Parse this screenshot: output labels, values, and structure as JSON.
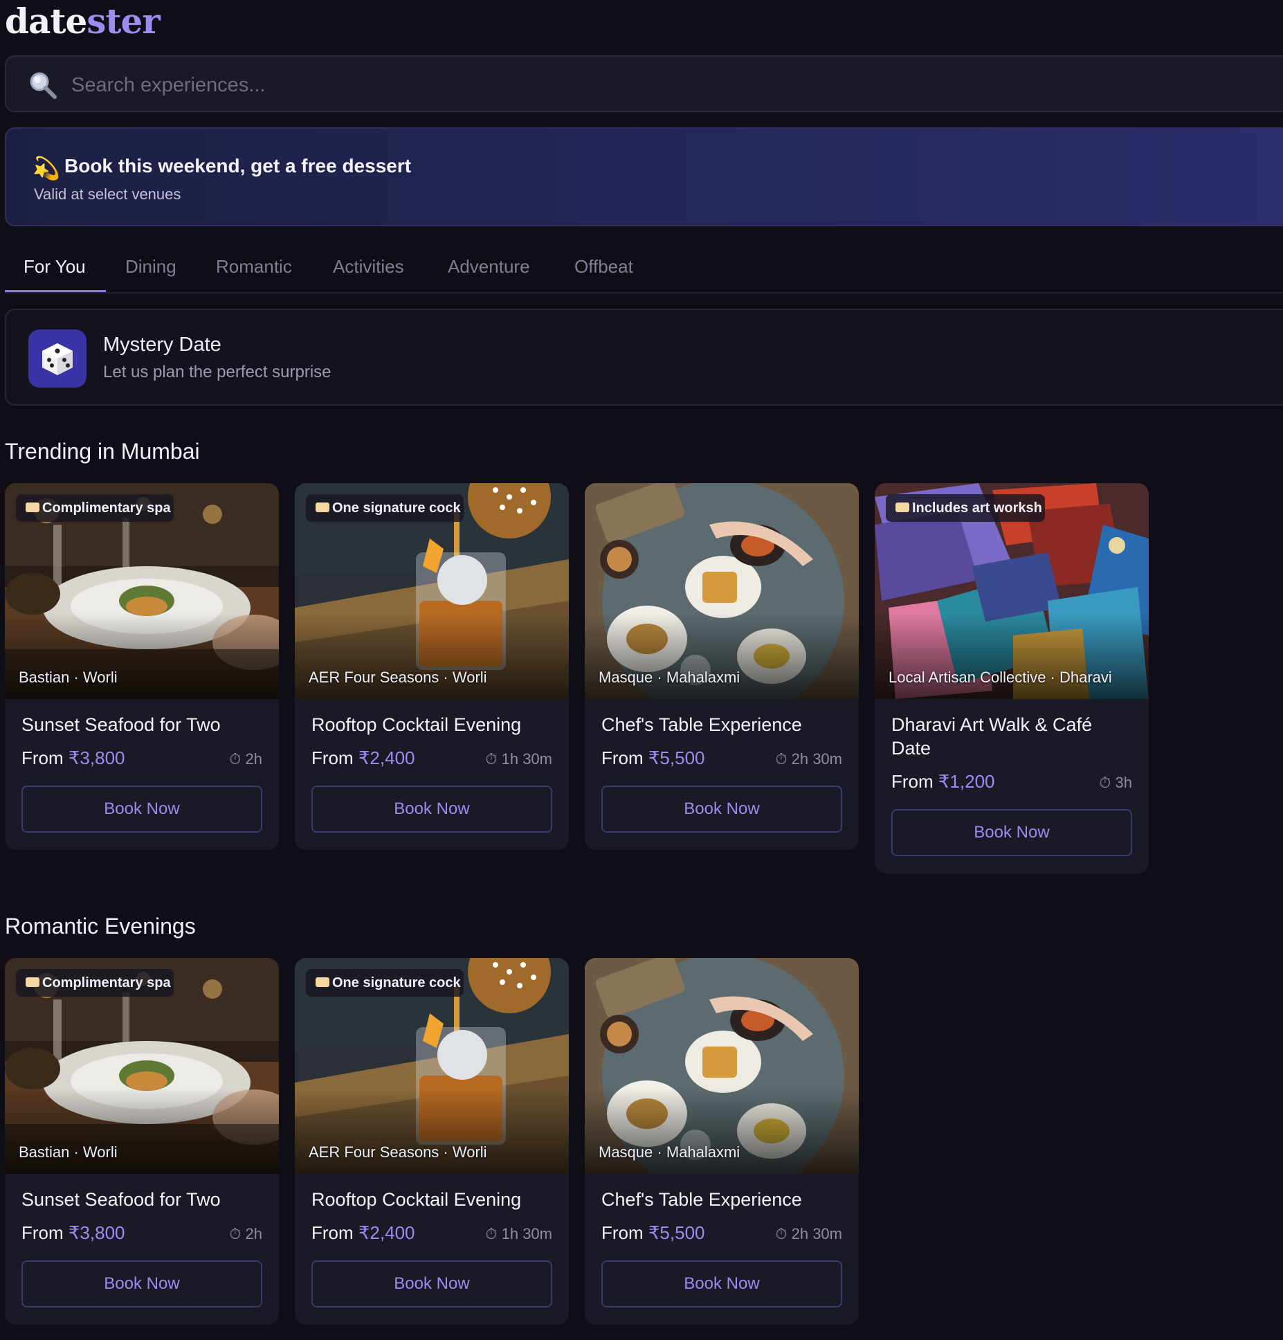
{
  "logo": {
    "part1": "date",
    "part2": "ster"
  },
  "search": {
    "placeholder": "Search experiences..."
  },
  "promo": {
    "icon": "💫",
    "title": "Book this weekend, get a free dessert",
    "subtitle": "Valid at select venues"
  },
  "tabs": [
    "For You",
    "Dining",
    "Romantic",
    "Activities",
    "Adventure",
    "Offbeat"
  ],
  "active_tab": "For You",
  "mystery": {
    "title": "Mystery Date",
    "subtitle": "Let us plan the perfect surprise",
    "icon": "dice-icon"
  },
  "sections": [
    {
      "title": "Trending in Mumbai",
      "cards": [
        {
          "badge": "Complimentary spa",
          "venue": "Bastian · Worli",
          "name": "Sunset Seafood for Two",
          "price_prefix": "From ",
          "price": "₹3,800",
          "duration": "⏱ 2h",
          "button": "Book Now",
          "image": "seafood-plate"
        },
        {
          "badge": "One signature cock",
          "venue": "AER Four Seasons · Worli",
          "name": "Rooftop Cocktail Evening",
          "price_prefix": "From ",
          "price": "₹2,400",
          "duration": "⏱ 1h 30m",
          "button": "Book Now",
          "image": "cocktail-glass"
        },
        {
          "badge": "",
          "venue": "Masque · Mahalaxmi",
          "name": "Chef's Table Experience",
          "price_prefix": "From ",
          "price": "₹5,500",
          "duration": "⏱ 2h 30m",
          "button": "Book Now",
          "image": "chefs-table"
        },
        {
          "badge": "Includes art worksh",
          "venue": "Local Artisan Collective · Dharavi",
          "name": "Dharavi Art Walk & Café Date",
          "price_prefix": "From ",
          "price": "₹1,200",
          "duration": "⏱ 3h",
          "button": "Book Now",
          "image": "paint-brushes"
        }
      ]
    },
    {
      "title": "Romantic Evenings",
      "cards": [
        {
          "badge": "Complimentary spa",
          "venue": "Bastian · Worli",
          "name": "Sunset Seafood for Two",
          "price_prefix": "From ",
          "price": "₹3,800",
          "duration": "⏱ 2h",
          "button": "Book Now",
          "image": "seafood-plate"
        },
        {
          "badge": "One signature cock",
          "venue": "AER Four Seasons · Worli",
          "name": "Rooftop Cocktail Evening",
          "price_prefix": "From ",
          "price": "₹2,400",
          "duration": "⏱ 1h 30m",
          "button": "Book Now",
          "image": "cocktail-glass"
        },
        {
          "badge": "",
          "venue": "Masque · Mahalaxmi",
          "name": "Chef's Table Experience",
          "price_prefix": "From ",
          "price": "₹5,500",
          "duration": "⏱ 2h 30m",
          "button": "Book Now",
          "image": "chefs-table"
        }
      ]
    }
  ],
  "colors": {
    "background": "#0f0e17",
    "card": "#1a1926",
    "accent": "#9b8cf2",
    "promo": "#24275a"
  }
}
